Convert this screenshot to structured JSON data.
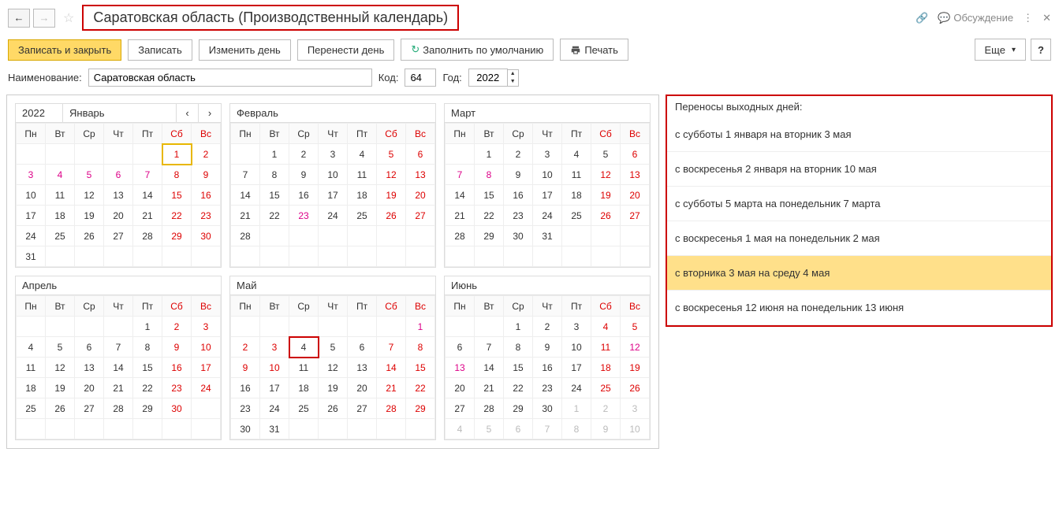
{
  "title": "Саратовская область (Производственный календарь)",
  "discussion_label": "Обсуждение",
  "toolbar": {
    "save_close": "Записать и закрыть",
    "save": "Записать",
    "edit_day": "Изменить день",
    "move_day": "Перенести день",
    "fill_default": "Заполнить по умолчанию",
    "print": "Печать",
    "more": "Еще",
    "help": "?"
  },
  "form": {
    "name_label": "Наименование:",
    "name_value": "Саратовская область",
    "code_label": "Код:",
    "code_value": "64",
    "year_label": "Год:",
    "year_value": "2022"
  },
  "dow": [
    "Пн",
    "Вт",
    "Ср",
    "Чт",
    "Пт",
    "Сб",
    "Вс"
  ],
  "year": "2022",
  "months": [
    {
      "name": "Январь",
      "header_year": true,
      "nav": true,
      "weeks": [
        [
          {
            "t": ""
          },
          {
            "t": ""
          },
          {
            "t": ""
          },
          {
            "t": ""
          },
          {
            "t": ""
          },
          {
            "t": "1",
            "c": "red",
            "hl": "yellow"
          },
          {
            "t": "2",
            "c": "red"
          }
        ],
        [
          {
            "t": "3",
            "c": "pink"
          },
          {
            "t": "4",
            "c": "pink"
          },
          {
            "t": "5",
            "c": "pink"
          },
          {
            "t": "6",
            "c": "pink"
          },
          {
            "t": "7",
            "c": "pink"
          },
          {
            "t": "8",
            "c": "red"
          },
          {
            "t": "9",
            "c": "red"
          }
        ],
        [
          {
            "t": "10"
          },
          {
            "t": "11"
          },
          {
            "t": "12"
          },
          {
            "t": "13"
          },
          {
            "t": "14"
          },
          {
            "t": "15",
            "c": "red"
          },
          {
            "t": "16",
            "c": "red"
          }
        ],
        [
          {
            "t": "17"
          },
          {
            "t": "18"
          },
          {
            "t": "19"
          },
          {
            "t": "20"
          },
          {
            "t": "21"
          },
          {
            "t": "22",
            "c": "red"
          },
          {
            "t": "23",
            "c": "red"
          }
        ],
        [
          {
            "t": "24"
          },
          {
            "t": "25"
          },
          {
            "t": "26"
          },
          {
            "t": "27"
          },
          {
            "t": "28"
          },
          {
            "t": "29",
            "c": "red"
          },
          {
            "t": "30",
            "c": "red"
          }
        ],
        [
          {
            "t": "31"
          },
          {
            "t": ""
          },
          {
            "t": ""
          },
          {
            "t": ""
          },
          {
            "t": ""
          },
          {
            "t": ""
          },
          {
            "t": ""
          }
        ]
      ]
    },
    {
      "name": "Февраль",
      "weeks": [
        [
          {
            "t": ""
          },
          {
            "t": "1"
          },
          {
            "t": "2"
          },
          {
            "t": "3"
          },
          {
            "t": "4"
          },
          {
            "t": "5",
            "c": "red"
          },
          {
            "t": "6",
            "c": "red"
          }
        ],
        [
          {
            "t": "7"
          },
          {
            "t": "8"
          },
          {
            "t": "9"
          },
          {
            "t": "10"
          },
          {
            "t": "11"
          },
          {
            "t": "12",
            "c": "red"
          },
          {
            "t": "13",
            "c": "red"
          }
        ],
        [
          {
            "t": "14"
          },
          {
            "t": "15"
          },
          {
            "t": "16"
          },
          {
            "t": "17"
          },
          {
            "t": "18"
          },
          {
            "t": "19",
            "c": "red"
          },
          {
            "t": "20",
            "c": "red"
          }
        ],
        [
          {
            "t": "21"
          },
          {
            "t": "22"
          },
          {
            "t": "23",
            "c": "pink"
          },
          {
            "t": "24"
          },
          {
            "t": "25"
          },
          {
            "t": "26",
            "c": "red"
          },
          {
            "t": "27",
            "c": "red"
          }
        ],
        [
          {
            "t": "28"
          },
          {
            "t": ""
          },
          {
            "t": ""
          },
          {
            "t": ""
          },
          {
            "t": ""
          },
          {
            "t": ""
          },
          {
            "t": ""
          }
        ],
        [
          {
            "t": ""
          },
          {
            "t": ""
          },
          {
            "t": ""
          },
          {
            "t": ""
          },
          {
            "t": ""
          },
          {
            "t": ""
          },
          {
            "t": ""
          }
        ]
      ]
    },
    {
      "name": "Март",
      "weeks": [
        [
          {
            "t": ""
          },
          {
            "t": "1"
          },
          {
            "t": "2"
          },
          {
            "t": "3"
          },
          {
            "t": "4"
          },
          {
            "t": "5"
          },
          {
            "t": "6",
            "c": "red"
          }
        ],
        [
          {
            "t": "7",
            "c": "pink"
          },
          {
            "t": "8",
            "c": "pink"
          },
          {
            "t": "9"
          },
          {
            "t": "10"
          },
          {
            "t": "11"
          },
          {
            "t": "12",
            "c": "red"
          },
          {
            "t": "13",
            "c": "red"
          }
        ],
        [
          {
            "t": "14"
          },
          {
            "t": "15"
          },
          {
            "t": "16"
          },
          {
            "t": "17"
          },
          {
            "t": "18"
          },
          {
            "t": "19",
            "c": "red"
          },
          {
            "t": "20",
            "c": "red"
          }
        ],
        [
          {
            "t": "21"
          },
          {
            "t": "22"
          },
          {
            "t": "23"
          },
          {
            "t": "24"
          },
          {
            "t": "25"
          },
          {
            "t": "26",
            "c": "red"
          },
          {
            "t": "27",
            "c": "red"
          }
        ],
        [
          {
            "t": "28"
          },
          {
            "t": "29"
          },
          {
            "t": "30"
          },
          {
            "t": "31"
          },
          {
            "t": ""
          },
          {
            "t": ""
          },
          {
            "t": ""
          }
        ],
        [
          {
            "t": ""
          },
          {
            "t": ""
          },
          {
            "t": ""
          },
          {
            "t": ""
          },
          {
            "t": ""
          },
          {
            "t": ""
          },
          {
            "t": ""
          }
        ]
      ]
    },
    {
      "name": "Апрель",
      "weeks": [
        [
          {
            "t": ""
          },
          {
            "t": ""
          },
          {
            "t": ""
          },
          {
            "t": ""
          },
          {
            "t": "1"
          },
          {
            "t": "2",
            "c": "red"
          },
          {
            "t": "3",
            "c": "red"
          }
        ],
        [
          {
            "t": "4"
          },
          {
            "t": "5"
          },
          {
            "t": "6"
          },
          {
            "t": "7"
          },
          {
            "t": "8"
          },
          {
            "t": "9",
            "c": "red"
          },
          {
            "t": "10",
            "c": "red"
          }
        ],
        [
          {
            "t": "11"
          },
          {
            "t": "12"
          },
          {
            "t": "13"
          },
          {
            "t": "14"
          },
          {
            "t": "15"
          },
          {
            "t": "16",
            "c": "red"
          },
          {
            "t": "17",
            "c": "red"
          }
        ],
        [
          {
            "t": "18"
          },
          {
            "t": "19"
          },
          {
            "t": "20"
          },
          {
            "t": "21"
          },
          {
            "t": "22"
          },
          {
            "t": "23",
            "c": "red"
          },
          {
            "t": "24",
            "c": "red"
          }
        ],
        [
          {
            "t": "25"
          },
          {
            "t": "26"
          },
          {
            "t": "27"
          },
          {
            "t": "28"
          },
          {
            "t": "29"
          },
          {
            "t": "30",
            "c": "red"
          },
          {
            "t": ""
          }
        ],
        [
          {
            "t": ""
          },
          {
            "t": ""
          },
          {
            "t": ""
          },
          {
            "t": ""
          },
          {
            "t": ""
          },
          {
            "t": ""
          },
          {
            "t": ""
          }
        ]
      ]
    },
    {
      "name": "Май",
      "weeks": [
        [
          {
            "t": ""
          },
          {
            "t": ""
          },
          {
            "t": ""
          },
          {
            "t": ""
          },
          {
            "t": ""
          },
          {
            "t": ""
          },
          {
            "t": "1",
            "c": "pink"
          }
        ],
        [
          {
            "t": "2",
            "c": "red"
          },
          {
            "t": "3",
            "c": "red"
          },
          {
            "t": "4",
            "hl": "red"
          },
          {
            "t": "5"
          },
          {
            "t": "6"
          },
          {
            "t": "7",
            "c": "red"
          },
          {
            "t": "8",
            "c": "red"
          }
        ],
        [
          {
            "t": "9",
            "c": "red"
          },
          {
            "t": "10",
            "c": "red"
          },
          {
            "t": "11"
          },
          {
            "t": "12"
          },
          {
            "t": "13"
          },
          {
            "t": "14",
            "c": "red"
          },
          {
            "t": "15",
            "c": "red"
          }
        ],
        [
          {
            "t": "16"
          },
          {
            "t": "17"
          },
          {
            "t": "18"
          },
          {
            "t": "19"
          },
          {
            "t": "20"
          },
          {
            "t": "21",
            "c": "red"
          },
          {
            "t": "22",
            "c": "red"
          }
        ],
        [
          {
            "t": "23"
          },
          {
            "t": "24"
          },
          {
            "t": "25"
          },
          {
            "t": "26"
          },
          {
            "t": "27"
          },
          {
            "t": "28",
            "c": "red"
          },
          {
            "t": "29",
            "c": "red"
          }
        ],
        [
          {
            "t": "30"
          },
          {
            "t": "31"
          },
          {
            "t": ""
          },
          {
            "t": ""
          },
          {
            "t": ""
          },
          {
            "t": ""
          },
          {
            "t": ""
          }
        ]
      ]
    },
    {
      "name": "Июнь",
      "weeks": [
        [
          {
            "t": ""
          },
          {
            "t": ""
          },
          {
            "t": "1"
          },
          {
            "t": "2"
          },
          {
            "t": "3"
          },
          {
            "t": "4",
            "c": "red"
          },
          {
            "t": "5",
            "c": "red"
          }
        ],
        [
          {
            "t": "6"
          },
          {
            "t": "7"
          },
          {
            "t": "8"
          },
          {
            "t": "9"
          },
          {
            "t": "10"
          },
          {
            "t": "11",
            "c": "red"
          },
          {
            "t": "12",
            "c": "pink"
          }
        ],
        [
          {
            "t": "13",
            "c": "pink"
          },
          {
            "t": "14"
          },
          {
            "t": "15"
          },
          {
            "t": "16"
          },
          {
            "t": "17"
          },
          {
            "t": "18",
            "c": "red"
          },
          {
            "t": "19",
            "c": "red"
          }
        ],
        [
          {
            "t": "20"
          },
          {
            "t": "21"
          },
          {
            "t": "22"
          },
          {
            "t": "23"
          },
          {
            "t": "24"
          },
          {
            "t": "25",
            "c": "red"
          },
          {
            "t": "26",
            "c": "red"
          }
        ],
        [
          {
            "t": "27"
          },
          {
            "t": "28"
          },
          {
            "t": "29"
          },
          {
            "t": "30"
          },
          {
            "t": "1",
            "c": "gray"
          },
          {
            "t": "2",
            "c": "gray"
          },
          {
            "t": "3",
            "c": "gray"
          }
        ],
        [
          {
            "t": "4",
            "c": "gray"
          },
          {
            "t": "5",
            "c": "gray"
          },
          {
            "t": "6",
            "c": "gray"
          },
          {
            "t": "7",
            "c": "gray"
          },
          {
            "t": "8",
            "c": "gray"
          },
          {
            "t": "9",
            "c": "gray"
          },
          {
            "t": "10",
            "c": "gray"
          }
        ]
      ]
    }
  ],
  "side": {
    "title": "Переносы выходных дней:",
    "items": [
      {
        "text": "с субботы 1 января на вторник 3 мая"
      },
      {
        "text": "с воскресенья 2 января на вторник 10 мая"
      },
      {
        "text": "с субботы 5 марта на понедельник 7 марта"
      },
      {
        "text": "с воскресенья 1 мая на понедельник 2 мая"
      },
      {
        "text": "с вторника 3 мая на среду 4 мая",
        "highlight": true
      },
      {
        "text": "с воскресенья 12 июня на понедельник 13 июня"
      }
    ]
  }
}
